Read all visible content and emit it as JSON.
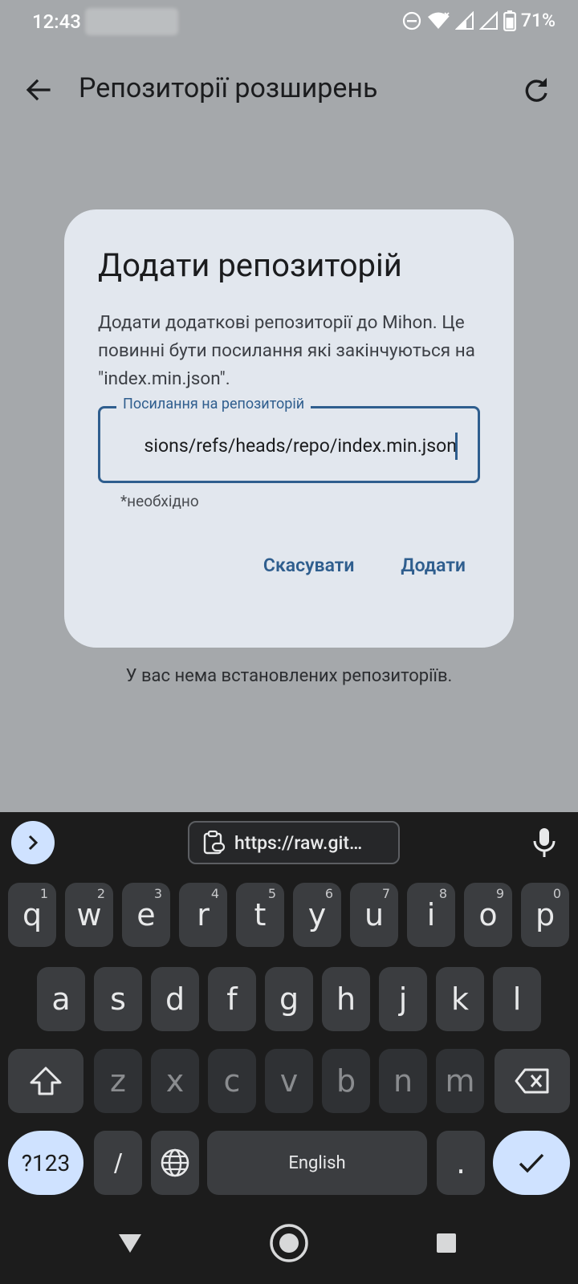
{
  "status_bar": {
    "time": "12:43",
    "battery": "71%"
  },
  "app_bar": {
    "title": "Репозиторії розширень"
  },
  "empty_state": "У вас нема встановлених репозиторіїв.",
  "dialog": {
    "title": "Додати репозиторій",
    "body": "Додати додаткові репозиторії до Mihon. Це повинні бути посилання які закінчуються на \"index.min.json\".",
    "field_label": "Посилання на репозиторій",
    "field_value": "sions/refs/heads/repo/index.min.json",
    "helper": "*необхідно",
    "cancel_label": "Скасувати",
    "confirm_label": "Додати"
  },
  "keyboard": {
    "clipboard_suggestion": "https://raw.git…",
    "row1": [
      {
        "k": "q",
        "n": "1"
      },
      {
        "k": "w",
        "n": "2"
      },
      {
        "k": "e",
        "n": "3"
      },
      {
        "k": "r",
        "n": "4"
      },
      {
        "k": "t",
        "n": "5"
      },
      {
        "k": "y",
        "n": "6"
      },
      {
        "k": "u",
        "n": "7"
      },
      {
        "k": "i",
        "n": "8"
      },
      {
        "k": "o",
        "n": "9"
      },
      {
        "k": "p",
        "n": "0"
      }
    ],
    "row2": [
      "a",
      "s",
      "d",
      "f",
      "g",
      "h",
      "j",
      "k",
      "l"
    ],
    "row3": [
      "z",
      "x",
      "c",
      "v",
      "b",
      "n",
      "m"
    ],
    "symbols_label": "?123",
    "slash": "/",
    "space_label": "English",
    "period": "."
  },
  "icons": {
    "back": "arrow-left-icon",
    "refresh": "refresh-icon",
    "expand": "chevron-right-icon",
    "clipboard": "clipboard-link-icon",
    "mic": "mic-icon",
    "shift": "shift-icon",
    "backspace": "backspace-icon",
    "globe": "globe-icon",
    "enter": "checkmark-icon"
  }
}
